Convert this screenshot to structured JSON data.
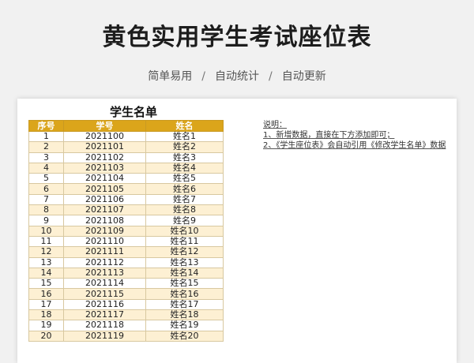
{
  "header": {
    "title": "黄色实用学生考试座位表",
    "subtitle_parts": [
      "简单易用",
      "自动统计",
      "自动更新"
    ],
    "separator": "/"
  },
  "roster": {
    "title": "学生名单",
    "columns": [
      "序号",
      "学号",
      "姓名"
    ],
    "rows": [
      [
        "1",
        "2021100",
        "姓名1"
      ],
      [
        "2",
        "2021101",
        "姓名2"
      ],
      [
        "3",
        "2021102",
        "姓名3"
      ],
      [
        "4",
        "2021103",
        "姓名4"
      ],
      [
        "5",
        "2021104",
        "姓名5"
      ],
      [
        "6",
        "2021105",
        "姓名6"
      ],
      [
        "7",
        "2021106",
        "姓名7"
      ],
      [
        "8",
        "2021107",
        "姓名8"
      ],
      [
        "9",
        "2021108",
        "姓名9"
      ],
      [
        "10",
        "2021109",
        "姓名10"
      ],
      [
        "11",
        "2021110",
        "姓名11"
      ],
      [
        "12",
        "2021111",
        "姓名12"
      ],
      [
        "13",
        "2021112",
        "姓名13"
      ],
      [
        "14",
        "2021113",
        "姓名14"
      ],
      [
        "15",
        "2021114",
        "姓名15"
      ],
      [
        "16",
        "2021115",
        "姓名16"
      ],
      [
        "17",
        "2021116",
        "姓名17"
      ],
      [
        "18",
        "2021117",
        "姓名18"
      ],
      [
        "19",
        "2021118",
        "姓名19"
      ],
      [
        "20",
        "2021119",
        "姓名20"
      ]
    ]
  },
  "notes": {
    "heading": "说明：",
    "lines": [
      "1、新增数据，直接在下方添加即可；",
      "2、《学生座位表》会自动引用《修改学生名单》数据"
    ]
  },
  "colors": {
    "header_fill": "#dba51b",
    "row_alt_fill": "#fdf0d3"
  }
}
